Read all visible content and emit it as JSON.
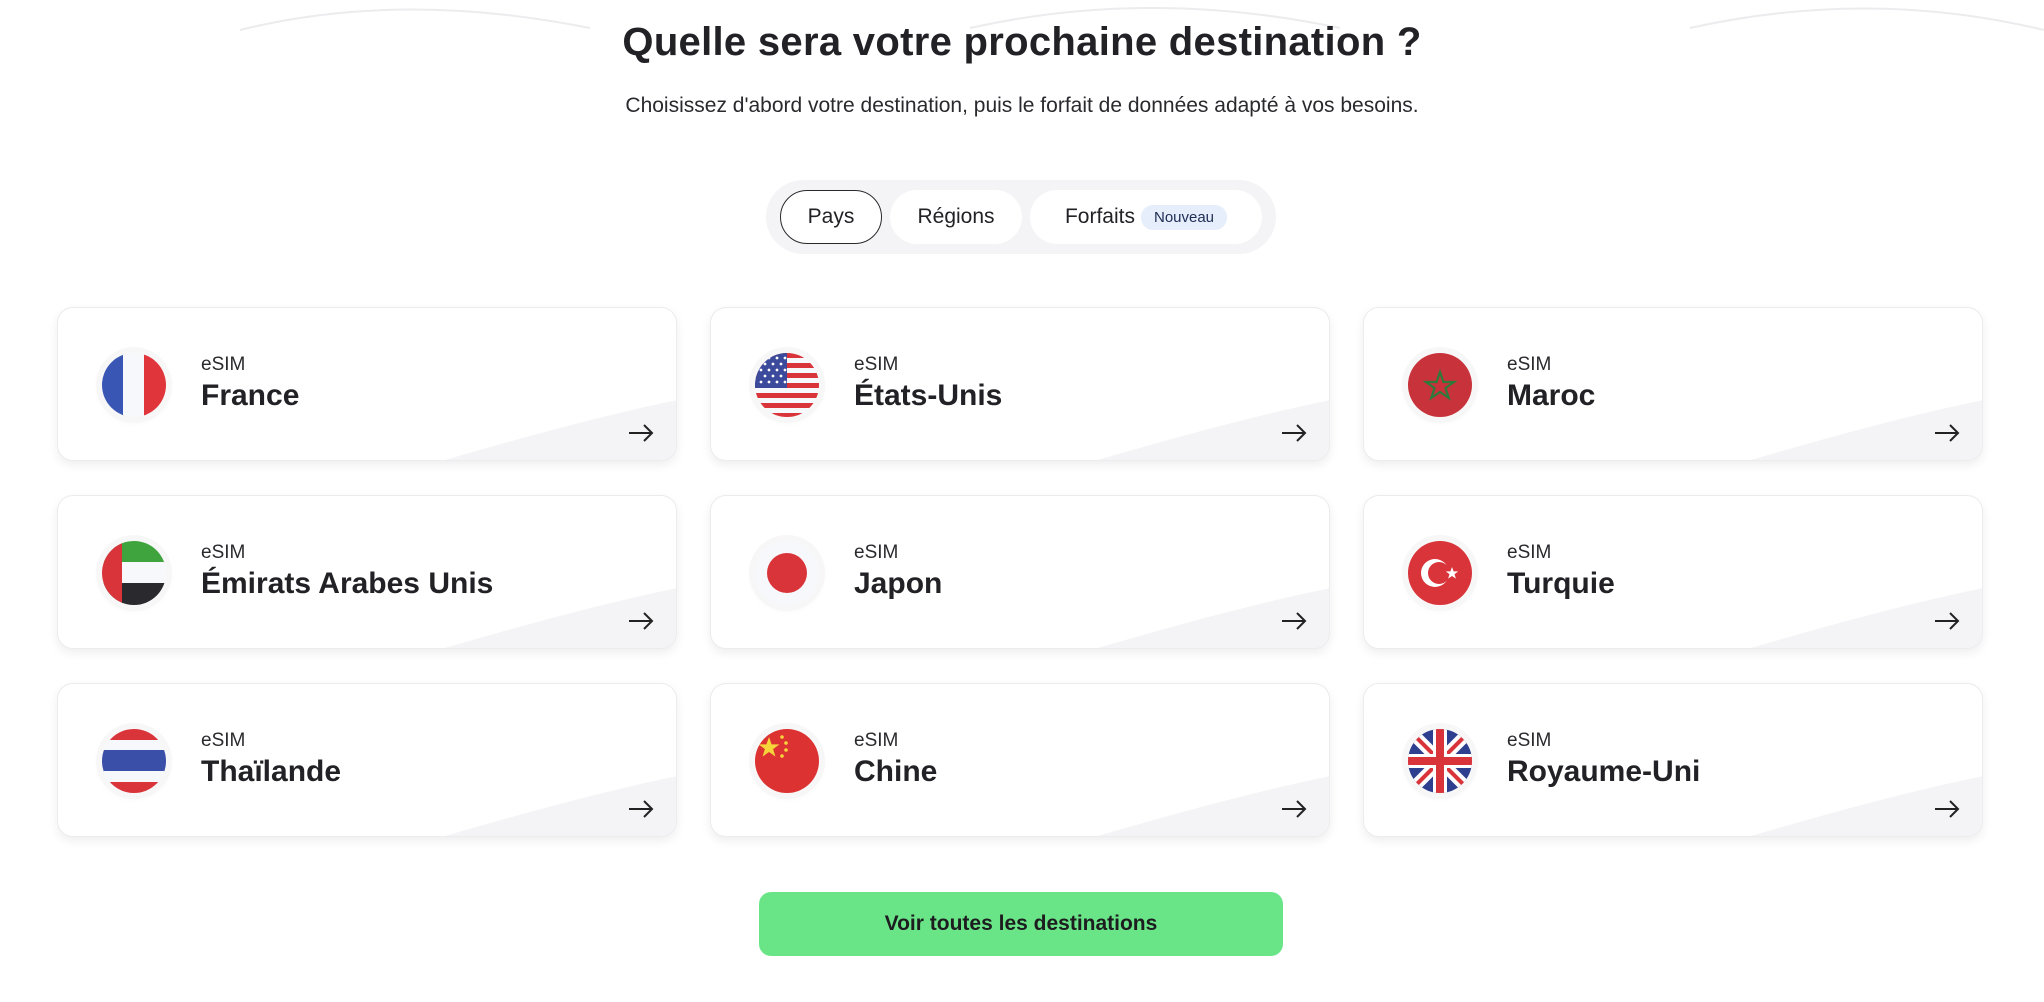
{
  "header": {
    "title": "Quelle sera votre prochaine destination ?",
    "subtitle": "Choisissez d'abord votre destination, puis le forfait de données adapté à vos besoins."
  },
  "tabs": {
    "pays": "Pays",
    "regions": "Régions",
    "forfaits": "Forfaits",
    "forfaits_badge": "Nouveau",
    "active": "Pays"
  },
  "destinations": [
    {
      "prefix": "eSIM",
      "name": "France",
      "flag_icon": "france-flag-icon"
    },
    {
      "prefix": "eSIM",
      "name": "États-Unis",
      "flag_icon": "usa-flag-icon"
    },
    {
      "prefix": "eSIM",
      "name": "Maroc",
      "flag_icon": "morocco-flag-icon"
    },
    {
      "prefix": "eSIM",
      "name": "Émirats Arabes Unis",
      "flag_icon": "uae-flag-icon"
    },
    {
      "prefix": "eSIM",
      "name": "Japon",
      "flag_icon": "japan-flag-icon"
    },
    {
      "prefix": "eSIM",
      "name": "Turquie",
      "flag_icon": "turkey-flag-icon"
    },
    {
      "prefix": "eSIM",
      "name": "Thaïlande",
      "flag_icon": "thailand-flag-icon"
    },
    {
      "prefix": "eSIM",
      "name": "Chine",
      "flag_icon": "china-flag-icon"
    },
    {
      "prefix": "eSIM",
      "name": "Royaume-Uni",
      "flag_icon": "uk-flag-icon"
    }
  ],
  "cta": {
    "label": "Voir toutes les destinations"
  },
  "colors": {
    "cta_background": "#69e588",
    "badge_background": "#e6eefc",
    "tab_bar_background": "#f4f4f6"
  }
}
